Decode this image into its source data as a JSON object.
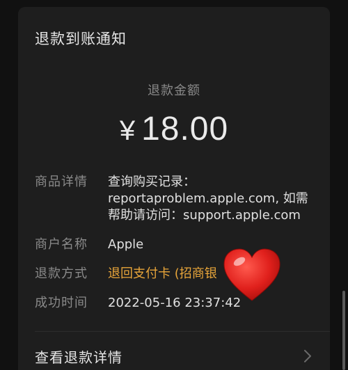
{
  "notification": {
    "title": "退款到账通知",
    "amount_label": "退款金额",
    "currency_symbol": "¥",
    "amount": "18.00",
    "rows": [
      {
        "label": "商品详情",
        "value": "查询购买记录：\nreportaproblem.apple.com, 如需\n帮助请访问：support.apple.com"
      },
      {
        "label": "商户名称",
        "value": "Apple"
      },
      {
        "label": "退款方式",
        "value": "退回支付卡 (招商银"
      },
      {
        "label": "成功时间",
        "value": "2022-05-16 23:37:42"
      }
    ],
    "detail_link": "查看退款详情"
  },
  "colors": {
    "background": "#111111",
    "card": "#1e1e1e",
    "accent_orange": "#e8a53a",
    "heart": "#e0201c"
  },
  "icons": {
    "heart": "heart-emoji-icon",
    "chevron": "chevron-right-icon"
  }
}
